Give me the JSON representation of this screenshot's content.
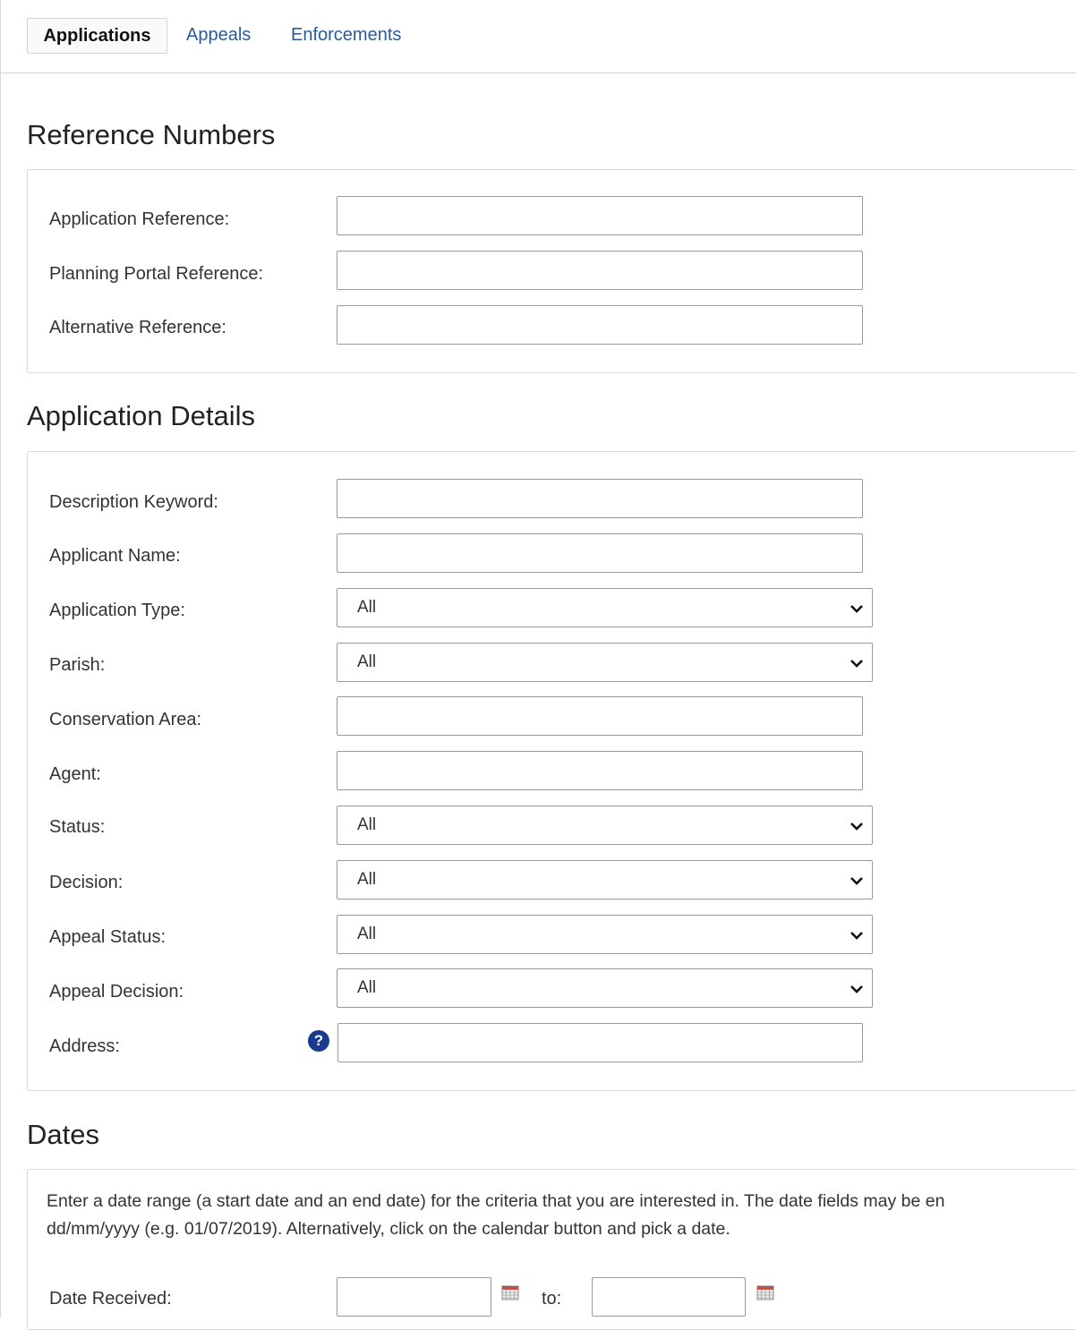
{
  "tabs": [
    {
      "label": "Applications",
      "active": true
    },
    {
      "label": "Appeals",
      "active": false
    },
    {
      "label": "Enforcements",
      "active": false
    }
  ],
  "reference_numbers": {
    "heading": "Reference Numbers",
    "fields": [
      {
        "label": "Application Reference:",
        "value": ""
      },
      {
        "label": "Planning Portal Reference:",
        "value": ""
      },
      {
        "label": "Alternative Reference:",
        "value": ""
      }
    ]
  },
  "application_details": {
    "heading": "Application Details",
    "description_keyword": {
      "label": "Description Keyword:",
      "value": ""
    },
    "applicant_name": {
      "label": "Applicant Name:",
      "value": ""
    },
    "application_type": {
      "label": "Application Type:",
      "selected": "All"
    },
    "parish": {
      "label": "Parish:",
      "selected": "All"
    },
    "conservation_area": {
      "label": "Conservation Area:",
      "value": ""
    },
    "agent": {
      "label": "Agent:",
      "value": ""
    },
    "status": {
      "label": "Status:",
      "selected": "All"
    },
    "decision": {
      "label": "Decision:",
      "selected": "All"
    },
    "appeal_status": {
      "label": "Appeal Status:",
      "selected": "All"
    },
    "appeal_decision": {
      "label": "Appeal Decision:",
      "selected": "All"
    },
    "address": {
      "label": "Address:",
      "value": "",
      "help_icon": "question-circle-icon",
      "help_glyph": "?"
    }
  },
  "dates": {
    "heading": "Dates",
    "info_line1": "Enter a date range (a start date and an end date) for the criteria that you are interested in. The date fields may be en",
    "info_line2": "dd/mm/yyyy (e.g. 01/07/2019). Alternatively, click on the calendar button and pick a date.",
    "date_received": {
      "label": "Date Received:",
      "to_label": "to:",
      "from_value": "",
      "to_value": ""
    }
  },
  "colors": {
    "link": "#2a5a9e",
    "help_icon": "#1a3a8f",
    "border": "#d9d9d9"
  }
}
